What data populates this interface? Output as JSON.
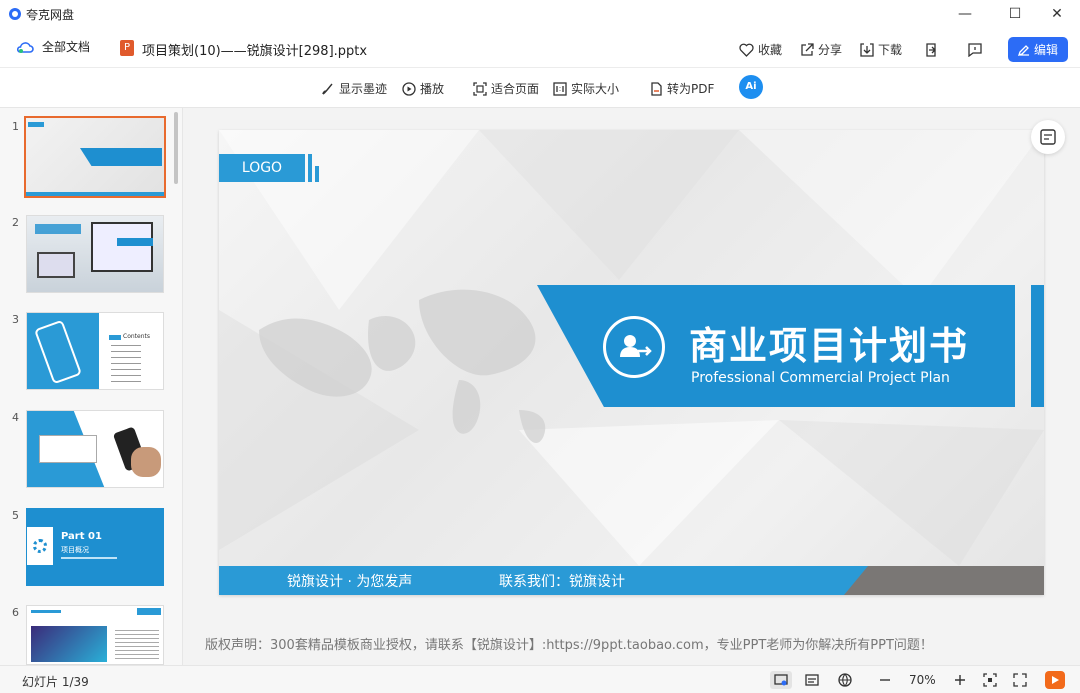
{
  "app": {
    "title": "夸克网盘"
  },
  "window_controls": {
    "minimize": "—",
    "maximize": "☐",
    "close": "✕"
  },
  "toolbar1": {
    "all_docs": "全部文档",
    "file_badge": "P",
    "file_name": "项目策划(10)——锐旗设计[298].pptx",
    "favorite": "收藏",
    "share": "分享",
    "download": "下载",
    "edit": "编辑"
  },
  "toolbar2": {
    "show_ink": "显示墨迹",
    "play": "播放",
    "fit_page": "适合页面",
    "actual_size": "实际大小",
    "to_pdf": "转为PDF",
    "ai": "Ai"
  },
  "sidebar": {
    "thumbs": [
      {
        "num": "1"
      },
      {
        "num": "2"
      },
      {
        "num": "3"
      },
      {
        "num": "4"
      },
      {
        "num": "5",
        "part": "Part 01",
        "sub": "项目概况"
      },
      {
        "num": "6"
      }
    ],
    "thumb3_contents": "Contents"
  },
  "slide": {
    "logo": "LOGO",
    "title": "商业项目计划书",
    "subtitle": "Professional Commercial Project Plan",
    "footer_left": "锐旗设计 · 为您发声",
    "footer_right": "联系我们：锐旗设计"
  },
  "copyright": "版权声明：300套精品模板商业授权，请联系【锐旗设计】:https://9ppt.taobao.com，专业PPT老师为你解决所有PPT问题！",
  "status": {
    "slide_counter": "幻灯片 1/39",
    "zoom": "70%"
  },
  "colors": {
    "accent": "#2c6cf6",
    "slide_blue": "#2a9ad6",
    "selected_thumb": "#e86a2e"
  }
}
